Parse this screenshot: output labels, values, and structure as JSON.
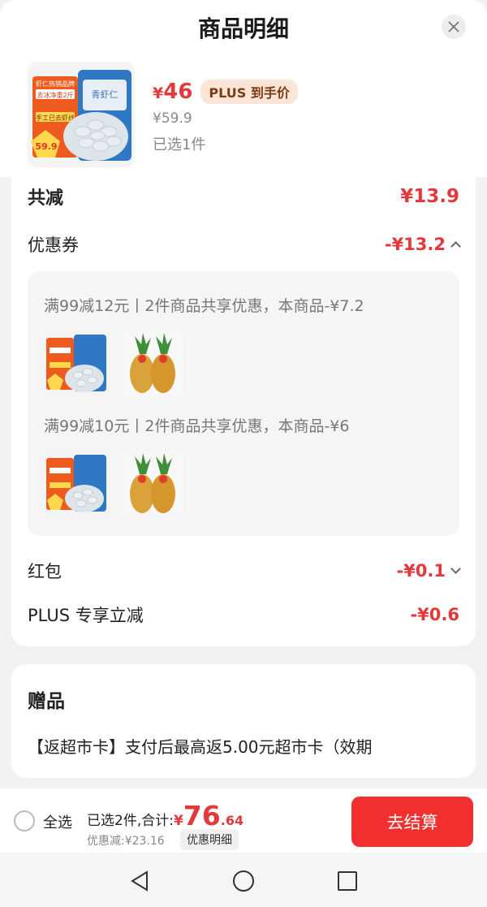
{
  "header": {
    "title": "商品明细"
  },
  "product": {
    "price_yen": "¥",
    "price_now": "46",
    "plus_tag": "PLUS 到手价",
    "price_old": "¥59.9",
    "selected": "已选1件"
  },
  "product_image_text": {
    "banner": "虾仁热销品牌",
    "net": "去冰净重2斤",
    "badge": "手工已去虾线",
    "price": "59.9",
    "pack": "青虾仁"
  },
  "discounts": {
    "total_label": "共减",
    "total_value": "¥13.9",
    "coupon_label": "优惠券",
    "coupon_value": "-¥13.2",
    "coupons": [
      {
        "text": "满99减12元丨2件商品共享优惠，本商品-¥7.2"
      },
      {
        "text": "满99减10元丨2件商品共享优惠，本商品-¥6"
      }
    ],
    "redpacket_label": "红包",
    "redpacket_value": "-¥0.1",
    "plus_label": "PLUS 专享立减",
    "plus_value": "-¥0.6"
  },
  "gift": {
    "title": "赠品",
    "text": "【返超市卡】支付后最高返5.00元超市卡（效期"
  },
  "footer": {
    "select_all": "全选",
    "summary_label": "已选2件,合计:",
    "total_yen": "¥",
    "total_int": "76",
    "total_dec": ".64",
    "saved": "优惠减:¥23.16",
    "detail_button": "优惠明细",
    "checkout": "去结算"
  },
  "colors": {
    "accent": "#e4393c",
    "checkout": "#f23030",
    "plus_tag_bg": "#fbe5d6"
  }
}
